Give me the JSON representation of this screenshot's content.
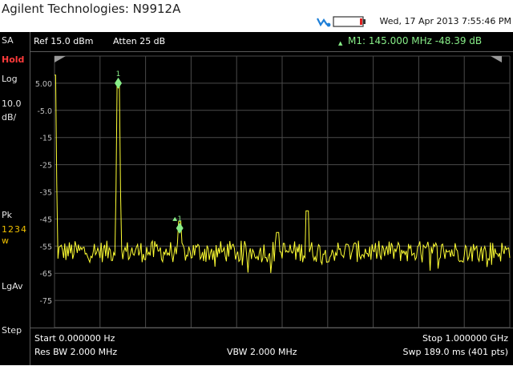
{
  "app": {
    "title": "Agilent Technologies: N9912A",
    "datetime": "Wed, 17 Apr 2013 7:55:46 PM"
  },
  "sidebar": {
    "mode": "SA",
    "hold": "Hold",
    "scale_type": "Log",
    "scale_value": "10.0",
    "scale_unit": "dB/",
    "detector": "Pk",
    "traces": "1234",
    "trace_state": "w",
    "averaging": "LgAv",
    "sweep_mode": "Step"
  },
  "header": {
    "ref_level": "Ref 15.0 dBm",
    "attenuation": "Atten 25 dB",
    "marker_readout": "M1:  145.000 MHz  -48.39 dB"
  },
  "plot": {
    "y_ticks": [
      "5.00",
      "-5.0",
      "-15",
      "-25",
      "-35",
      "-45",
      "-55",
      "-65",
      "-75"
    ],
    "marker1_label": "1",
    "marker2_label": "1"
  },
  "footer": {
    "start": "Start 0.000000  Hz",
    "stop": "Stop 1.000000 GHz",
    "res_bw": "Res BW 2.000 MHz",
    "vbw": "VBW 2.000 MHz",
    "sweep": "Swp 189.0 ms (401 pts)"
  },
  "colors": {
    "trace": "#ffff33",
    "marker": "#88ee88",
    "hold": "#ff3b3b",
    "traces_label": "#f0c000"
  },
  "chart_data": {
    "type": "line",
    "x_range_mhz": [
      0,
      1000
    ],
    "y_range_db": [
      15,
      -85
    ],
    "points": 401,
    "noise_floor_db": -57,
    "peaks": [
      {
        "freq_mhz": 0,
        "level_db": 8
      },
      {
        "freq_mhz": 140,
        "level_db": 5
      },
      {
        "freq_mhz": 275,
        "level_db": -46
      },
      {
        "freq_mhz": 490,
        "level_db": -50
      },
      {
        "freq_mhz": 555,
        "level_db": -42
      }
    ],
    "markers": [
      {
        "label": "1",
        "freq_mhz": 140,
        "level_db": 5
      },
      {
        "label": "1",
        "freq_mhz": 275,
        "level_db": -48.39
      }
    ]
  }
}
